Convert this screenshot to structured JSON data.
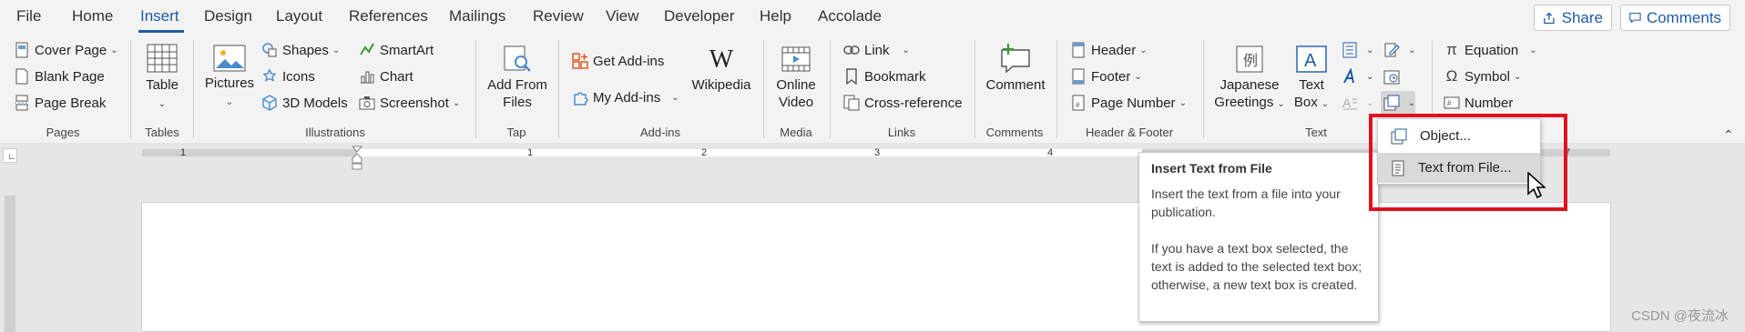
{
  "tabs": [
    {
      "label": "File"
    },
    {
      "label": "Home"
    },
    {
      "label": "Insert"
    },
    {
      "label": "Design"
    },
    {
      "label": "Layout"
    },
    {
      "label": "References"
    },
    {
      "label": "Mailings"
    },
    {
      "label": "Review"
    },
    {
      "label": "View"
    },
    {
      "label": "Developer"
    },
    {
      "label": "Help"
    },
    {
      "label": "Accolade"
    }
  ],
  "active_tab": "Insert",
  "top_buttons": {
    "share": "Share",
    "comments": "Comments"
  },
  "ribbon": {
    "pages": {
      "cover_page": "Cover Page",
      "blank_page": "Blank Page",
      "page_break": "Page Break",
      "group": "Pages"
    },
    "tables": {
      "table": "Table",
      "group": "Tables"
    },
    "illustrations": {
      "pictures": "Pictures",
      "shapes": "Shapes",
      "icons": "Icons",
      "models": "3D Models",
      "smartart": "SmartArt",
      "chart": "Chart",
      "screenshot": "Screenshot",
      "group": "Illustrations"
    },
    "tap": {
      "add_from": "Add From",
      "files": "Files",
      "group": "Tap"
    },
    "addins": {
      "get": "Get Add-ins",
      "my": "My Add-ins",
      "wikipedia": "Wikipedia",
      "group": "Add-ins"
    },
    "media": {
      "online": "Online",
      "video": "Video",
      "group": "Media"
    },
    "links": {
      "link": "Link",
      "bookmark": "Bookmark",
      "cross_ref": "Cross-reference",
      "group": "Links"
    },
    "comments": {
      "comment": "Comment",
      "group": "Comments"
    },
    "header_footer": {
      "header": "Header",
      "footer": "Footer",
      "page_number": "Page Number",
      "group": "Header & Footer"
    },
    "text": {
      "japanese": "Japanese",
      "greetings": "Greetings",
      "text": "Text",
      "box": "Box",
      "group": "Text"
    },
    "symbols": {
      "equation": "Equation",
      "symbol": "Symbol",
      "number": "Number"
    }
  },
  "ruler": {
    "numbers": [
      "1",
      "1",
      "2",
      "3",
      "4",
      "7"
    ]
  },
  "tooltip": {
    "title": "Insert Text from File",
    "p1": "Insert the text from a file into your publication.",
    "p2": "If you have a text box selected, the text is added to the selected text box; otherwise, a new text box is created."
  },
  "dropdown": {
    "object": "Object...",
    "text_from_file": "Text from File..."
  },
  "watermark": "CSDN @夜流冰",
  "colors": {
    "accent": "#1f5aa6",
    "highlight": "#e0101f"
  }
}
